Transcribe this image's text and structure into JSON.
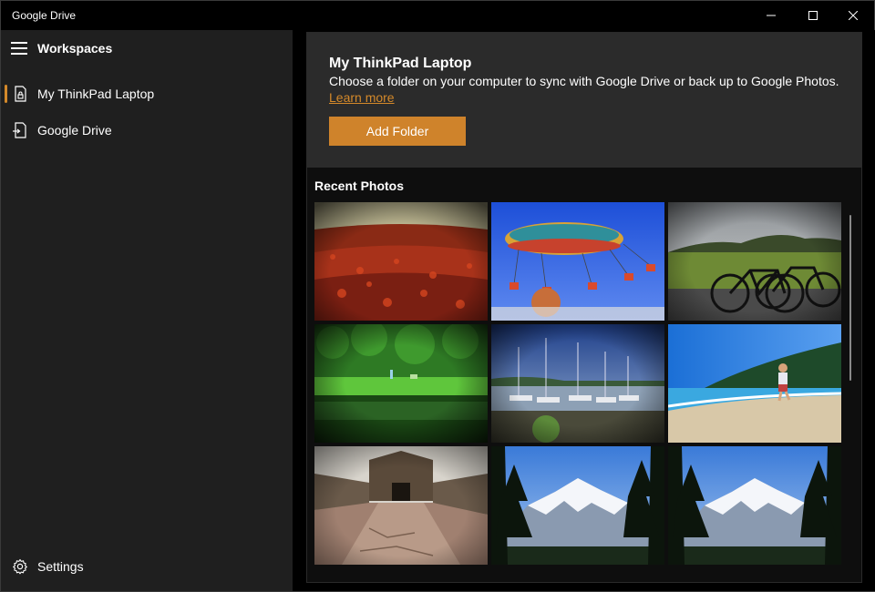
{
  "window": {
    "title": "Google Drive"
  },
  "sidebar": {
    "header_label": "Workspaces",
    "items": [
      {
        "label": "My ThinkPad Laptop",
        "icon": "laptop-sync-icon",
        "selected": true
      },
      {
        "label": "Google Drive",
        "icon": "drive-sync-icon",
        "selected": false
      }
    ],
    "settings_label": "Settings"
  },
  "main": {
    "title": "My ThinkPad Laptop",
    "description": "Choose a folder on your computer to sync with Google Drive or back up to Google Photos.",
    "learn_more": "Learn more",
    "add_folder_label": "Add Folder",
    "recent_photos_title": "Recent Photos",
    "photos": [
      {
        "subject": "red-leaves-path"
      },
      {
        "subject": "carnival-swing-ride"
      },
      {
        "subject": "bicycle-in-field"
      },
      {
        "subject": "green-pond"
      },
      {
        "subject": "harbor-sailboats"
      },
      {
        "subject": "child-on-beach"
      },
      {
        "subject": "fort-gate-ruins"
      },
      {
        "subject": "snowy-mountain"
      },
      {
        "subject": "snowy-mountain"
      }
    ]
  },
  "colors": {
    "accent": "#cf832b",
    "sidebar_bg": "#1f1f1f",
    "card_header_bg": "#2b2b2b"
  }
}
